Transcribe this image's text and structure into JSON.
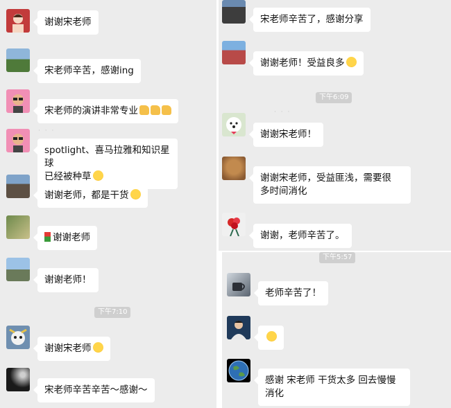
{
  "left": {
    "messages": [
      {
        "text": "谢谢宋老师",
        "emoji": ""
      },
      {
        "text": "宋老师辛苦，感谢ing",
        "emoji": ""
      },
      {
        "text": "宋老师的演讲非常专业",
        "emoji": "👍👍👍"
      },
      {
        "line1": "spotlight、喜马拉雅和知识星球",
        "line2": "已经被种草",
        "emoji": "🤣"
      },
      {
        "text": "谢谢老师，都是干货",
        "emoji": "🤔"
      },
      {
        "text": "谢谢老师",
        "emoji": "🌹"
      },
      {
        "text": "谢谢老师！",
        "emoji": ""
      },
      {
        "text": "谢谢宋老师",
        "emoji": "😊"
      },
      {
        "text": "宋老师辛苦辛苦～感谢～",
        "emoji": ""
      }
    ],
    "time_710": "下午7:10"
  },
  "right_top": {
    "messages": [
      {
        "text": "宋老师辛苦了，感谢分享",
        "emoji": ""
      },
      {
        "text": "谢谢老师！受益良多",
        "emoji": "😊"
      },
      {
        "text": "谢谢宋老师！",
        "emoji": ""
      },
      {
        "line1": "谢谢宋老师，受益匪浅，需要很",
        "line2": "多时间消化",
        "emoji": ""
      },
      {
        "text": "谢谢，老师辛苦了。",
        "emoji": ""
      }
    ],
    "time_609": "下午6:09"
  },
  "right_bottom": {
    "messages": [
      {
        "text": "老师辛苦了！",
        "emoji": ""
      },
      {
        "text": "",
        "emoji": "🤔"
      },
      {
        "line1": "感谢 宋老师 干货太多 回去慢慢",
        "line2": "消化",
        "emoji": ""
      }
    ],
    "time_557": "下午5:57"
  },
  "colors": {
    "bg": "#ececec",
    "bubble": "#ffffff",
    "time_pill": "#cfcfcf"
  }
}
